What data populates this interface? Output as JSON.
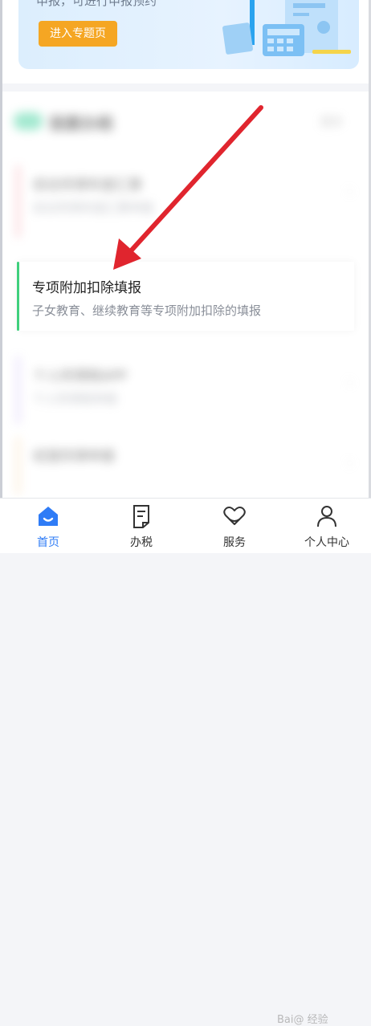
{
  "banner": {
    "text": "申报，可进行申报预约",
    "enter_button": "进入专题页"
  },
  "section": {
    "title": "我要办税",
    "more": "更多"
  },
  "items": [
    {
      "title": "综合所得年度汇算",
      "subtitle": "综合所得年度汇算申报"
    },
    {
      "title": "专项附加扣除填报",
      "subtitle": "子女教育、继续教育等专项附加扣除的填报"
    },
    {
      "title": "个人所得税APP",
      "subtitle": "个人所得税申报"
    },
    {
      "title": "经营所得申报",
      "subtitle": ""
    }
  ],
  "tabbar": [
    {
      "label": "首页",
      "active": true
    },
    {
      "label": "办税",
      "active": false
    },
    {
      "label": "服务",
      "active": false
    },
    {
      "label": "个人中心",
      "active": false
    }
  ],
  "watermark": "Bai@ 经验",
  "colors": {
    "accent": "#2f7cf6",
    "button": "#f5a623",
    "arrow": "#e0252e",
    "active_bar": "#3ecf7c"
  }
}
